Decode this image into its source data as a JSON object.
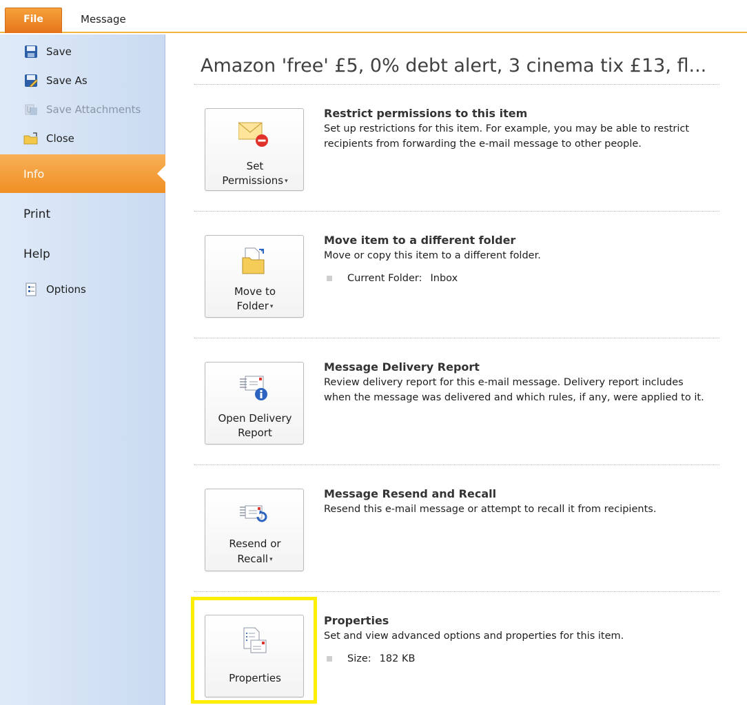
{
  "tabs": {
    "file": "File",
    "message": "Message"
  },
  "sidebar": {
    "commands": [
      {
        "label": "Save",
        "icon": "save-icon",
        "enabled": true
      },
      {
        "label": "Save As",
        "icon": "save-as-icon",
        "enabled": true
      },
      {
        "label": "Save Attachments",
        "icon": "save-attachments-icon",
        "enabled": false
      },
      {
        "label": "Close",
        "icon": "close-folder-icon",
        "enabled": true
      }
    ],
    "nav": {
      "info": "Info",
      "print": "Print",
      "help": "Help",
      "options": "Options"
    },
    "options_icon": "options-icon"
  },
  "page_title": "Amazon 'free' £5, 0% debt alert, 3 cinema tix £13, fl...",
  "sections": [
    {
      "button_line1": "Set",
      "button_line2": "Permissions",
      "button_icon": "envelope-permission-icon",
      "title": "Restrict permissions to this item",
      "description": "Set up restrictions for this item. For example, you may be able to restrict recipients from forwarding the e-mail message to other people."
    },
    {
      "button_line1": "Move to",
      "button_line2": "Folder",
      "button_icon": "move-folder-icon",
      "title": "Move item to a different folder",
      "description": "Move or copy this item to a different folder.",
      "bullet_label": "Current Folder:",
      "bullet_value": "Inbox"
    },
    {
      "button_line1": "Open Delivery",
      "button_line2": "Report",
      "button_icon": "delivery-report-icon",
      "title": "Message Delivery Report",
      "description": "Review delivery report for this e-mail message. Delivery report includes when the message was delivered and which rules, if any, were applied to it."
    },
    {
      "button_line1": "Resend or",
      "button_line2": "Recall",
      "button_icon": "resend-recall-icon",
      "title": "Message Resend and Recall",
      "description": "Resend this e-mail message or attempt to recall it from recipients."
    },
    {
      "button_line1": "Properties",
      "button_icon": "properties-icon",
      "title": "Properties",
      "description": "Set and view advanced options and properties for this item.",
      "bullet_label": "Size:",
      "bullet_value": "182 KB"
    }
  ],
  "dropdown_glyph": "▾",
  "colors": {
    "accent_orange": "#f08f24",
    "ribbon_border": "#f2b43c",
    "highlight_yellow": "#ffee00",
    "sidebar_blue": "#c9daf1"
  }
}
